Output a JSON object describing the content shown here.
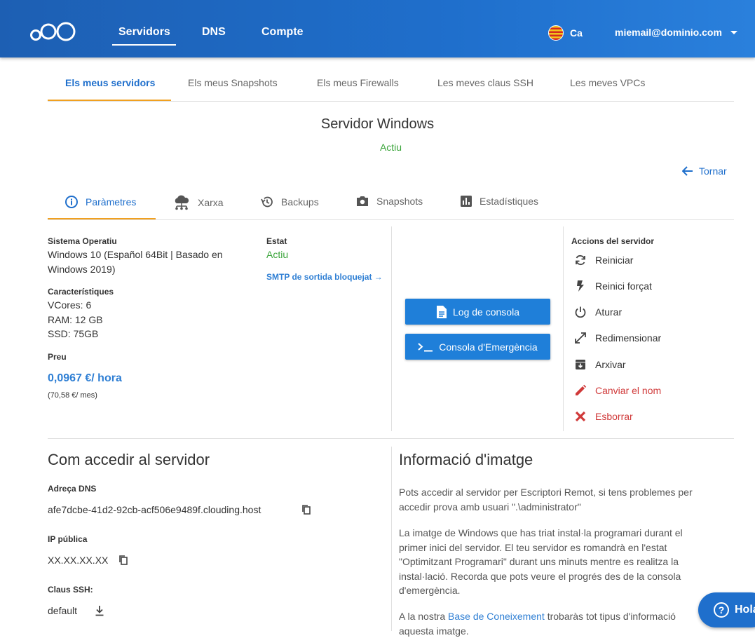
{
  "header": {
    "nav": [
      "Servidors",
      "DNS",
      "Compte"
    ],
    "lang": "Ca",
    "user_email": "miemail@dominio.com"
  },
  "top_tabs": [
    "Els meus servidors",
    "Els meus Snapshots",
    "Els meus Firewalls",
    "Les meves claus SSH",
    "Les meves VPCs"
  ],
  "server": {
    "title": "Servidor Windows",
    "status": "Actiu",
    "back_label": "Tornar"
  },
  "sub_tabs": [
    "Paràmetres",
    "Xarxa",
    "Backups",
    "Snapshots",
    "Estadístiques"
  ],
  "params": {
    "os_label": "Sistema Operatiu",
    "os_value_line1": "Windows 10 (Español 64Bit | Basado en",
    "os_value_line2": "Windows 2019)",
    "specs_label": "Característiques",
    "vcores": "VCores: 6",
    "ram": "RAM: 12 GB",
    "ssd": "SSD: 75GB",
    "price_label": "Preu",
    "price_hour": "0,0967 €/ hora",
    "price_month": "(70,58 €/ mes)",
    "state_label": "Estat",
    "state_value": "Actiu",
    "smtp_link": "SMTP de sortida bloquejat →"
  },
  "console": {
    "log_label": "Log de consola",
    "emergency_label": "Consola d'Emergència"
  },
  "actions": {
    "title": "Accions del servidor",
    "items": [
      {
        "label": "Reiniciar",
        "icon": "restart-icon",
        "color": "#333333"
      },
      {
        "label": "Reinici forçat",
        "icon": "bolt-icon",
        "color": "#333333"
      },
      {
        "label": "Aturar",
        "icon": "power-icon",
        "color": "#333333"
      },
      {
        "label": "Redimensionar",
        "icon": "resize-icon",
        "color": "#333333"
      },
      {
        "label": "Arxivar",
        "icon": "archive-icon",
        "color": "#333333"
      },
      {
        "label": "Canviar el nom",
        "icon": "pencil-icon",
        "color": "#d03a3a"
      },
      {
        "label": "Esborrar",
        "icon": "close-icon",
        "color": "#d03a3a"
      }
    ]
  },
  "access": {
    "title": "Com accedir al servidor",
    "dns_label": "Adreça DNS",
    "dns_value": "afe7dcbe-41d2-92cb-acf506e9489f.clouding.host",
    "ip_label": "IP pública",
    "ip_value": "XX.XX.XX.XX",
    "ssh_label": "Claus SSH:",
    "ssh_value": "default"
  },
  "image_info": {
    "title": "Informació d'imatge",
    "p1_l1": "Pots accedir al servidor per Escriptori Remot, si tens problemes per",
    "p1_l2": "accedir prova amb usuari \".\\administrator\"",
    "p2_l1": "La imatge de Windows que has triat instal·la programari durant el",
    "p2_l2": "primer inici del servidor. El teu servidor es romandrà en l'estat",
    "p2_l3": "\"Optimitzant Programari\" durant uns minuts mentre es realitza la",
    "p2_l4": "instal·lació. Recorda que pots veure el progrés des de la consola",
    "p2_l5": "d'emergència.",
    "p3_prefix": "A la nostra ",
    "p3_link": "Base de Coneixement",
    "p3_suffix": " trobaràs tot tipus d'informació",
    "p3_l2": "aquesta imatge."
  },
  "help_label": "Hola"
}
